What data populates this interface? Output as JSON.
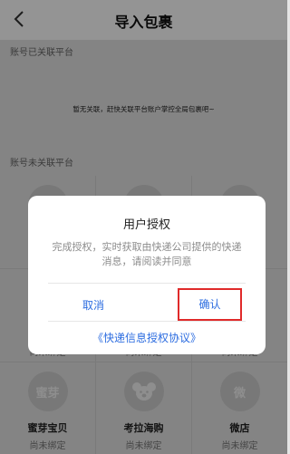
{
  "header": {
    "title": "导入包裹",
    "back_icon": "chevron-left-icon"
  },
  "linked_section": {
    "label": "账号已关联平台",
    "empty_hint": "暂无关联，赶快关联平台账户掌控全局包裹吧~"
  },
  "unlinked_section": {
    "label": "账号未关联平台"
  },
  "platforms": [
    {
      "icon_text": "",
      "name": "",
      "status": ""
    },
    {
      "icon_text": "",
      "name": "",
      "status": ""
    },
    {
      "icon_text": "",
      "name": "",
      "status": ""
    },
    {
      "icon_text": "",
      "name": "",
      "status": "尚未绑定"
    },
    {
      "icon_text": "",
      "name": "",
      "status": "尚未绑定"
    },
    {
      "icon_text": "",
      "name": "",
      "status": "尚未绑定"
    },
    {
      "icon_text": "蜜芽",
      "name": "蜜芽宝贝",
      "status": "尚未绑定"
    },
    {
      "icon_text": "",
      "icon": "koala-icon",
      "name": "考拉海购",
      "status": "尚未绑定"
    },
    {
      "icon_text": "微",
      "name": "微店",
      "status": "尚未绑定"
    }
  ],
  "dialog": {
    "title": "用户授权",
    "message": "完成授权，实时获取由快递公司提供的快递消息，请阅读并同意",
    "cancel_label": "取消",
    "confirm_label": "确认",
    "agreement_link": "《快递信息授权协议》"
  },
  "colors": {
    "accent": "#2d6de0",
    "highlight_border": "#e02a2a",
    "overlay": "rgba(0,0,0,0.42)"
  }
}
